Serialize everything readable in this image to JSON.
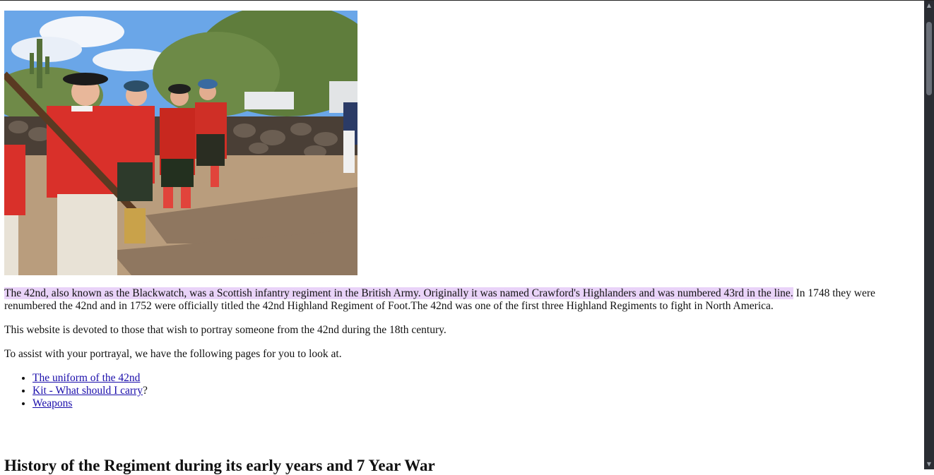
{
  "photo": {
    "alt": "Reenactors of the 42nd Highland Regiment in red coats and kilts standing in a line with muskets"
  },
  "intro": {
    "highlighted": "The 42nd, also known as the Blackwatch, was a Scottish infantry regiment in the British Army. Originally it was named Crawford's Highlanders and was numbered 43rd in the line.",
    "rest": " In 1748 they were renumbered the 42nd and in 1752 were officially titled the 42nd Highland Regiment of Foot.The 42nd was one of the first three Highland Regiments to fight in North America."
  },
  "paragraph2": "This website is devoted to those that wish to portray someone from the 42nd during the 18th century.",
  "paragraph3": "To assist with your portrayal, we have the following pages for you to look at.",
  "links": [
    {
      "label": "The uniform of the 42nd",
      "suffix": ""
    },
    {
      "label": "Kit - What should I carry",
      "suffix": "?"
    },
    {
      "label": "Weapons",
      "suffix": ""
    }
  ],
  "section_heading": "History of the Regiment during its early years and 7 Year War",
  "colors": {
    "highlight": "#e9d3f8",
    "link": "#1a0dab",
    "scrollbar": "#2a2d33"
  }
}
